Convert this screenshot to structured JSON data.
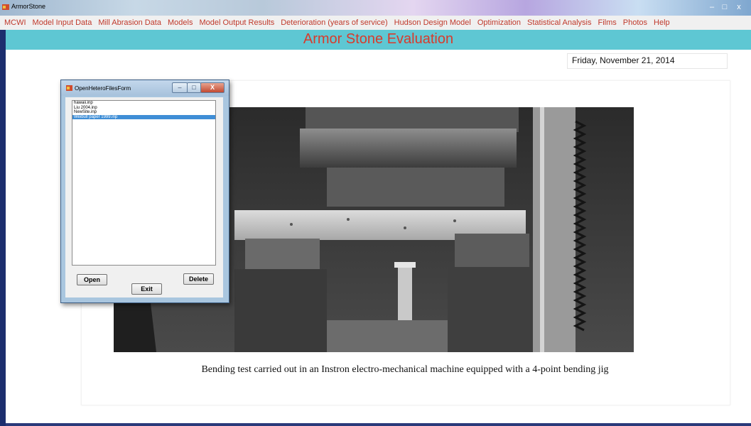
{
  "window": {
    "title": "ArmorStone"
  },
  "menu": {
    "items": [
      "MCWI",
      "Model Input Data",
      "Mill Abrasion Data",
      "Models",
      "Model Output Results",
      "Deterioration (years of service)",
      "Hudson Design Model",
      "Optimization",
      "Statistical Analysis",
      "Films",
      "Photos",
      "Help"
    ]
  },
  "header": {
    "title": "Armor Stone Evaluation"
  },
  "date": "Friday, November 21, 2014",
  "figure": {
    "caption": "Bending test carried out in an Instron electro-mechanical machine equipped with a 4-point bending jig"
  },
  "dialog": {
    "title": "OpenHeteroFilesForm",
    "files": [
      "hawaii.inp",
      "Liu 2004.inp",
      "NewSite.inp",
      "Weibull paper 1999.inp"
    ],
    "selected_index": 3,
    "buttons": {
      "open": "Open",
      "delete": "Delete",
      "exit": "Exit"
    },
    "controls": {
      "minimize": "–",
      "maximize": "□",
      "close": "X"
    }
  },
  "window_controls": {
    "minimize": "–",
    "maximize": "□",
    "close": "x"
  },
  "colors": {
    "menu_text": "#c0392b",
    "header_bg": "#5ec7d3",
    "header_text": "#d93a2b",
    "selection": "#3f8ed6"
  }
}
